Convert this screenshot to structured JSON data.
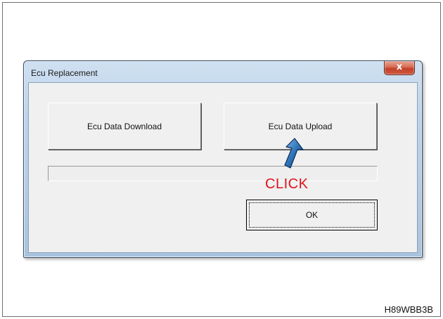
{
  "dialog": {
    "title": "Ecu Replacement",
    "close_glyph": "x",
    "download_label": "Ecu Data Download",
    "upload_label": "Ecu Data Upload",
    "ok_label": "OK",
    "progress": 0
  },
  "annotation": {
    "click_label": "CLICK",
    "pointer_icon": "arrow-pointer-icon",
    "click_color": "#e0121b"
  },
  "figure_code": "H89WBB3B"
}
